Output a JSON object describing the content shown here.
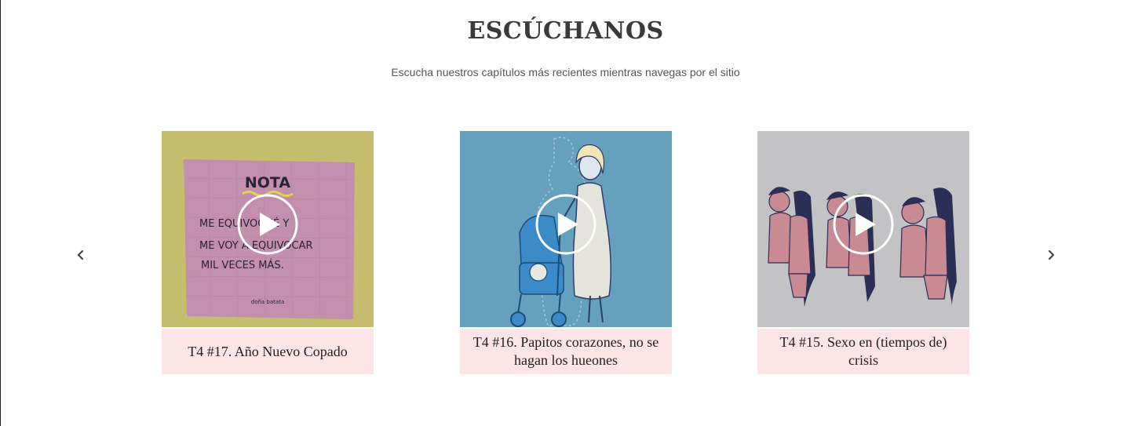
{
  "section": {
    "title": "ESCÚCHANOS",
    "subtitle": "Escucha nuestros capítulos más recientes mientras navegas por el sitio"
  },
  "carousel": {
    "prev_icon": "chevron-left-icon",
    "next_icon": "chevron-right-icon",
    "episodes": [
      {
        "title": "T4 #17. Año Nuevo Copado",
        "art": {
          "heading": "NOTA",
          "lines": [
            "ME EQUIVOQUÉ Y",
            "ME VOY A EQUIVOCAR",
            "MIL VECES MÁS."
          ],
          "signature": "doña batata",
          "bg": "#c5bd6e",
          "note": "#c28fac"
        }
      },
      {
        "title": "T4 #16. Papitos corazones, no se hagan los hueones",
        "art": {
          "bg": "#66a0bf"
        }
      },
      {
        "title": "T4 #15. Sexo en (tiempos de) crisis",
        "art": {
          "bg": "#c3c3c5"
        }
      }
    ]
  },
  "colors": {
    "caption_bg": "#fde5e7",
    "title": "#3a3a3a"
  }
}
